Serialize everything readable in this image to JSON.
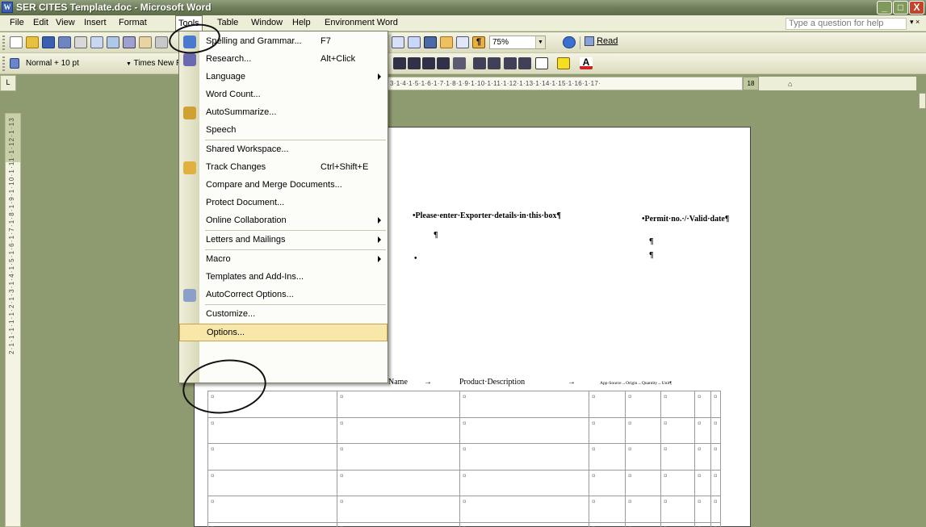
{
  "window": {
    "title": "SER CITES Template.doc - Microsoft Word",
    "app_icon": "W",
    "minimize": "_",
    "maximize": "□",
    "close": "X"
  },
  "menubar": {
    "items": [
      "File",
      "Edit",
      "View",
      "Insert",
      "Format",
      "Tools",
      "Table",
      "Window",
      "Help",
      "Environment Word"
    ],
    "active": "Tools",
    "help_box_placeholder": "Type a question for help",
    "help_arrow": "▾ ×"
  },
  "toolbar": {
    "zoom": "75%",
    "read_label": "Read",
    "style": "Normal + 10 pt",
    "font": "Times New Roman"
  },
  "tools_menu": {
    "items": [
      {
        "label": "Spelling and Grammar...",
        "shortcut": "F7",
        "icon": "spelling-icon"
      },
      {
        "label": "Research...",
        "shortcut": "Alt+Click",
        "icon": "research-icon"
      },
      {
        "label": "Language",
        "submenu": true
      },
      {
        "label": "Word Count..."
      },
      {
        "label": "AutoSummarize...",
        "icon": "autosummarize-icon"
      },
      {
        "label": "Speech"
      },
      {
        "label": "Shared Workspace..."
      },
      {
        "label": "Track Changes",
        "shortcut": "Ctrl+Shift+E",
        "icon": "track-changes-icon"
      },
      {
        "label": "Compare and Merge Documents..."
      },
      {
        "label": "Protect Document..."
      },
      {
        "label": "Online Collaboration",
        "submenu": true
      },
      {
        "label": "Letters and Mailings",
        "submenu": true
      },
      {
        "label": "Macro",
        "submenu": true
      },
      {
        "label": "Templates and Add-Ins..."
      },
      {
        "label": "AutoCorrect Options...",
        "icon": "autocorrect-icon"
      },
      {
        "label": "Customize..."
      },
      {
        "label": "Options...",
        "highlighted": true
      }
    ]
  },
  "document": {
    "exporter_text": "•Please·enter·Exporter·details·in·this·box¶",
    "permit_text": "•Permit·no.·/·Valid·date¶",
    "header_name": "Name",
    "header_product": "Product·Description",
    "header_small": "App·Source→Origin→Quantity→Unit¶",
    "arrow": "→",
    "cell_marker": "¤",
    "pilcrow": "¶",
    "bullet": "•"
  },
  "rulers": {
    "horizontal": "3·1·4·1·5·1·6·1·7·1·8·1·9·1·10·1·11·1·12·1·13·1·14·1·15·1·16·1·17·",
    "horizontal_end": "18",
    "vertical": "2·1·1·1·1·1·2·1·3·1·4·1·5·1·6·1·7·1·8·1·9·1·10·1·11·1·12·1·13",
    "corner": "L"
  }
}
